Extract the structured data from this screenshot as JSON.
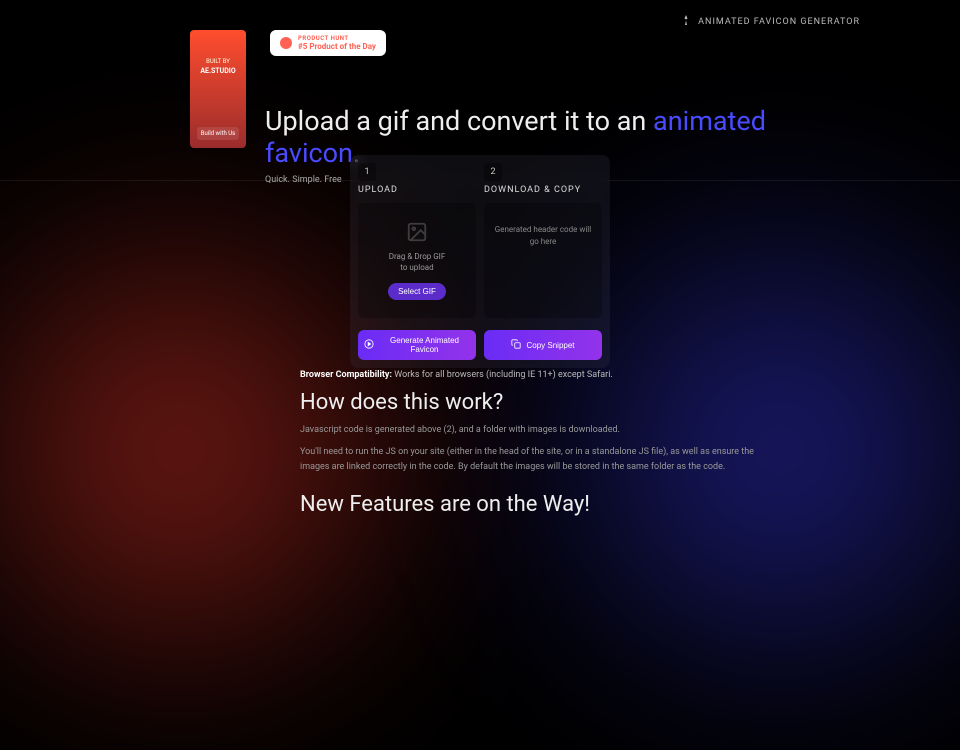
{
  "brand": {
    "name": "ANIMATED FAVICON GENERATOR"
  },
  "sidebar": {
    "built_by": "BUILT BY",
    "studio": "AE.STUDIO",
    "cta": "Build with Us"
  },
  "ph": {
    "label": "PRODUCT HUNT",
    "rank": "#5 Product of the Day"
  },
  "hero": {
    "line_a": "Upload a gif and convert it to an ",
    "line_accent": "animated favicon",
    "line_b": ".",
    "tagline": "Quick. Simple. Free"
  },
  "panel": {
    "step1_num": "1",
    "step1_title": "UPLOAD",
    "step2_num": "2",
    "step2_title": "DOWNLOAD & COPY",
    "drop_hint_a": "Drag & Drop GIF",
    "drop_hint_b": "to upload",
    "select_btn": "Select GIF",
    "code_placeholder": "Generated header code will go here",
    "generate_btn": "Generate Animated Favicon",
    "copy_btn": "Copy Snippet"
  },
  "info": {
    "compat_label": "Browser Compatibility:",
    "compat_text": " Works for all browsers (including IE 11+) except Safari.",
    "h2_a": "How does this work?",
    "p1": "Javascript code is generated above (2), and a folder with images is downloaded.",
    "p2": "You'll need to run the JS on your site (either in the head of the site, or in a standalone JS file), as well as ensure the images are linked correctly in the code. By default the images will be stored in the same folder as the code.",
    "h2_b": "New Features are on the Way!"
  }
}
